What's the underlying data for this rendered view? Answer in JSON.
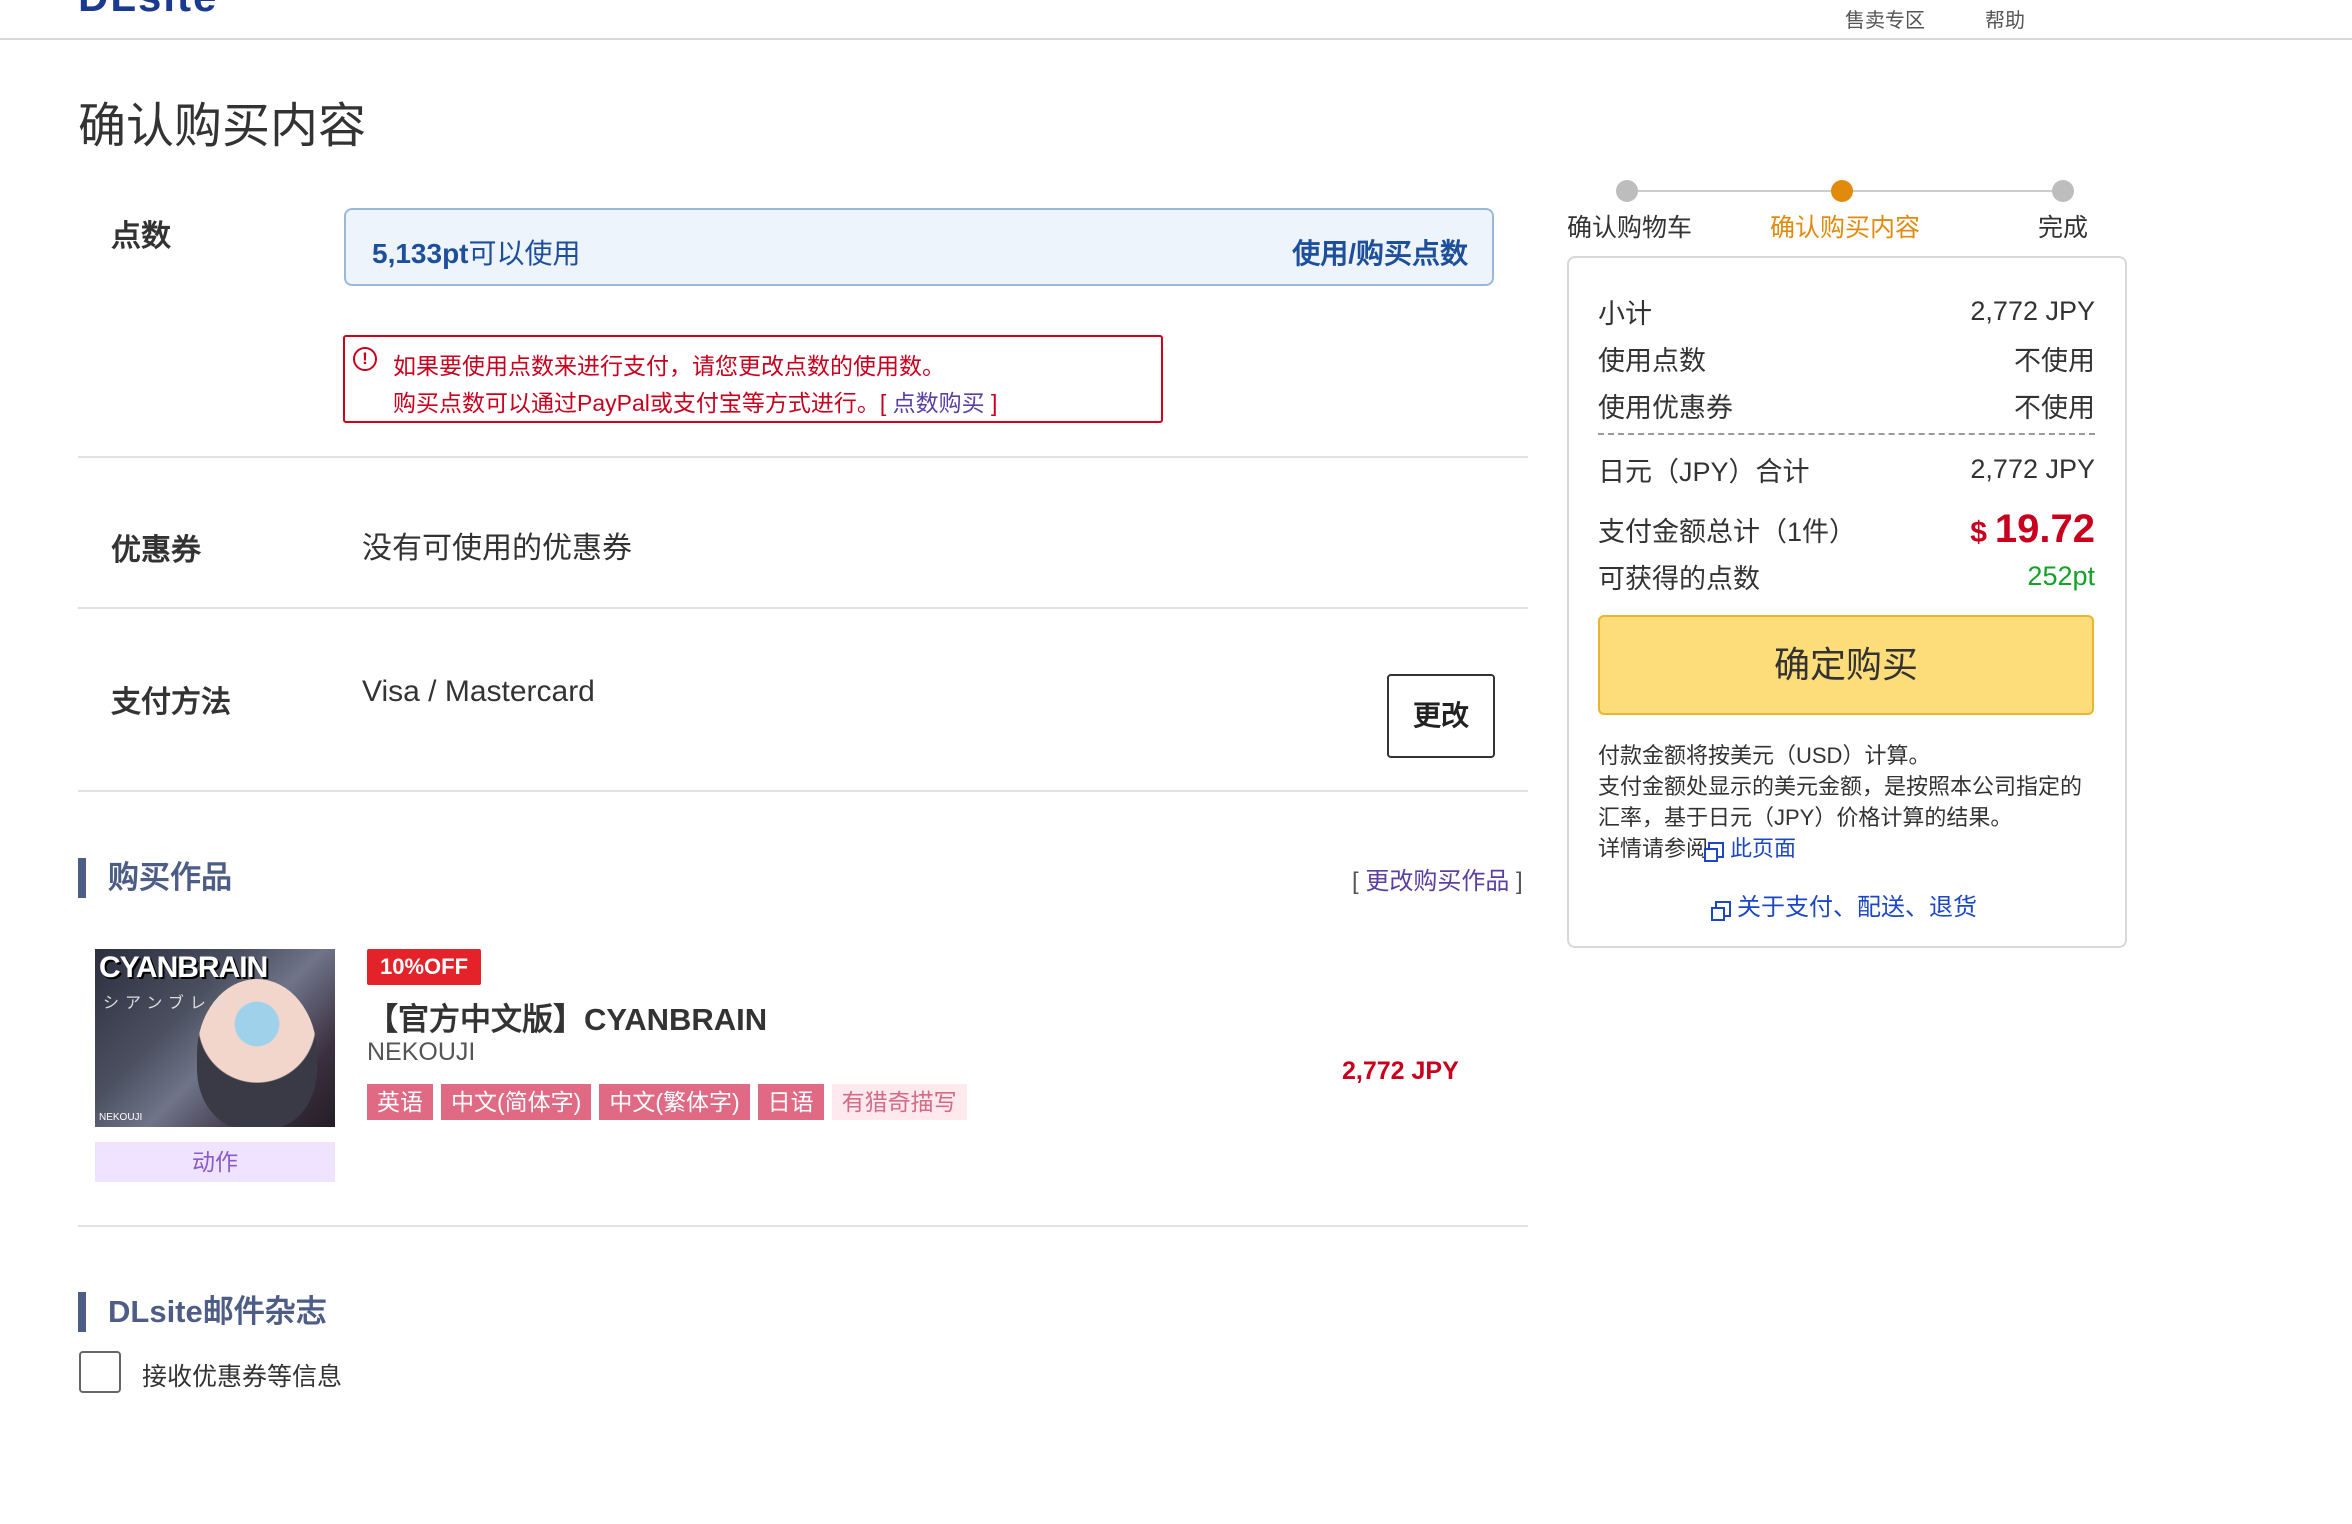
{
  "header": {
    "logo_text": "DLsite",
    "links": [
      "售卖专区",
      "帮助"
    ]
  },
  "page_title": "确认购买内容",
  "points": {
    "label": "点数",
    "amount": "5,133pt",
    "amount_suffix": "可以使用",
    "buy_label": "使用/购买点数",
    "warning_line1": "如果要使用点数来进行支付，请您更改点数的使用数。",
    "warning_line2": "购买点数可以通过PayPal或支付宝等方式进行。",
    "warning_link_open": "[ ",
    "warning_link": "点数购买",
    "warning_link_close": " ]"
  },
  "coupon": {
    "label": "优惠券",
    "value": "没有可使用的优惠券"
  },
  "payment": {
    "label": "支付方法",
    "value": "Visa / Mastercard",
    "change_label": "更改"
  },
  "items_section": {
    "title": "购买作品",
    "change_open": "[ ",
    "change_link": "更改购买作品",
    "change_close": " ]",
    "product": {
      "thumb_title": "CYANBRAIN",
      "thumb_subtitle": "シアンブレイン",
      "thumb_brand": "NEKOUJI",
      "genre": "动作",
      "discount": "10%OFF",
      "title": "【官方中文版】CYANBRAIN",
      "maker": "NEKOUJI",
      "tags": [
        "英语",
        "中文(简体字)",
        "中文(繁体字)",
        "日语"
      ],
      "tag_warning": "有猎奇描写",
      "price": "2,772 JPY"
    }
  },
  "newsletter": {
    "title": "DLsite邮件杂志",
    "checkbox_label": "接收优惠券等信息",
    "checked": false
  },
  "steps": {
    "items": [
      "确认购物车",
      "确认购买内容",
      "完成"
    ],
    "active_index": 1
  },
  "summary": {
    "subtotal_label": "小计",
    "subtotal": "2,772 JPY",
    "points_label": "使用点数",
    "points_value": "不使用",
    "coupon_label": "使用优惠券",
    "coupon_value": "不使用",
    "jpy_total_label": "日元（JPY）合计",
    "jpy_total": "2,772 JPY",
    "pay_total_label": "支付金额总计（1件）",
    "pay_currency": "$",
    "pay_total": "19.72",
    "earn_label": "可获得的点数",
    "earn_value": "252pt",
    "confirm_label": "确定购买",
    "note1": "付款金额将按美元（USD）计算。",
    "note2": "支付金额处显示的美元金额，是按照本公司指定的",
    "note3": "汇率，基于日元（JPY）价格计算的结果。",
    "note4_prefix": "详情请参阅",
    "note4_link": "此页面",
    "policy_link": "关于支付、配送、退货"
  },
  "colors": {
    "accent_orange": "#e18a0b",
    "price_red": "#c8001e",
    "link_blue": "#1c47c4",
    "points_blue": "#1e4f9c",
    "section_bar": "#4e5d86",
    "confirm_yellow": "#fddc7a"
  }
}
